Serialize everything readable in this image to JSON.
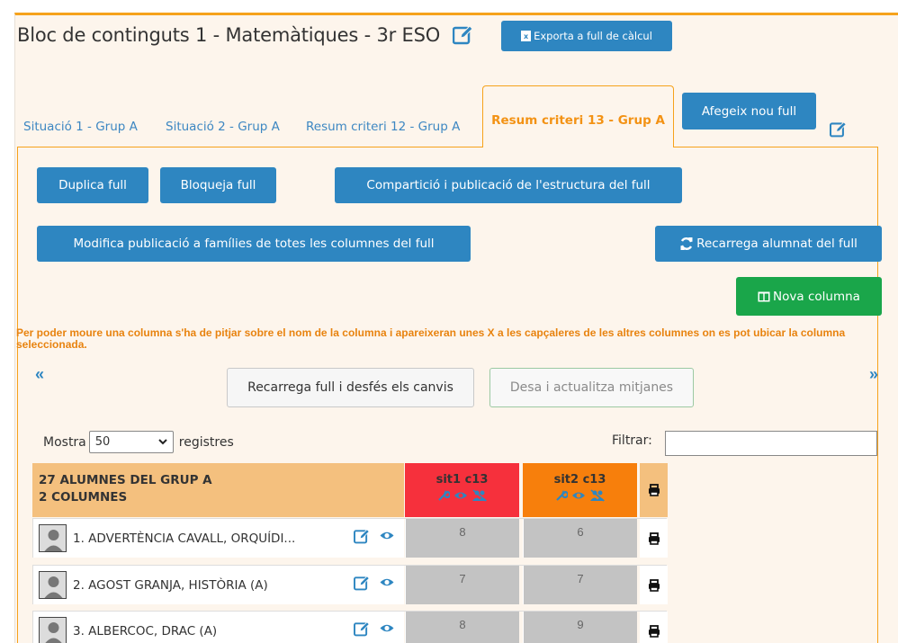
{
  "header": {
    "title": "Bloc de continguts 1 - Matemàtiques - 3r ESO",
    "export_label": "Exporta a full de càlcul"
  },
  "tabs": [
    {
      "label": "Situació 1 - Grup A",
      "active": false
    },
    {
      "label": "Situació 2 - Grup A",
      "active": false
    },
    {
      "label": "Resum criteri 12 - Grup A",
      "active": false
    },
    {
      "label": "Resum criteri 13 - Grup A",
      "active": true
    }
  ],
  "add_sheet_label": "Afegeix nou full",
  "actions": {
    "duplicate": "Duplica full",
    "lock": "Bloqueja full",
    "share": "Compartició i publicació de l'estructura del full",
    "modify_publication": "Modifica publicació a famílies de totes les columnes del full",
    "reload_students": "Recarrega alumnat del full",
    "new_column": "Nova columna"
  },
  "note": "Per poder moure una columna s'ha de pitjar sobre el nom de la columna i apareixeran unes X a les capçaleres de les altres columnes on es pot ubicar la columna seleccionada.",
  "nav": {
    "prev": "«",
    "next": "»"
  },
  "reload_sheet_label": "Recarrega full i desfés els canvis",
  "save_label": "Desa i actualitza mitjanes",
  "table_controls": {
    "show_prefix": "Mostra",
    "show_value": "50",
    "show_suffix": "registres",
    "filter_label": "Filtrar:"
  },
  "table": {
    "header_line1": "27 ALUMNES DEL GRUP A",
    "header_line2": "2 COLUMNES",
    "columns": [
      {
        "name": "sit1 c13",
        "color": "#f6303c"
      },
      {
        "name": "sit2 c13",
        "color": "#f77f0c"
      }
    ],
    "rows": [
      {
        "name": "1. ADVERTÈNCIA CAVALL, ORQUÍDI...",
        "grades": [
          "8",
          "6"
        ]
      },
      {
        "name": "2. AGOST GRANJA, HISTÒRIA (A)",
        "grades": [
          "7",
          "7"
        ]
      },
      {
        "name": "3. ALBERCOC, DRAC (A)",
        "grades": [
          "8",
          "9"
        ]
      }
    ]
  },
  "colors": {
    "accent_orange": "#f6a21b",
    "button_blue": "#2e86c1",
    "button_green": "#1aa64a",
    "link_blue": "#3d87c2"
  }
}
